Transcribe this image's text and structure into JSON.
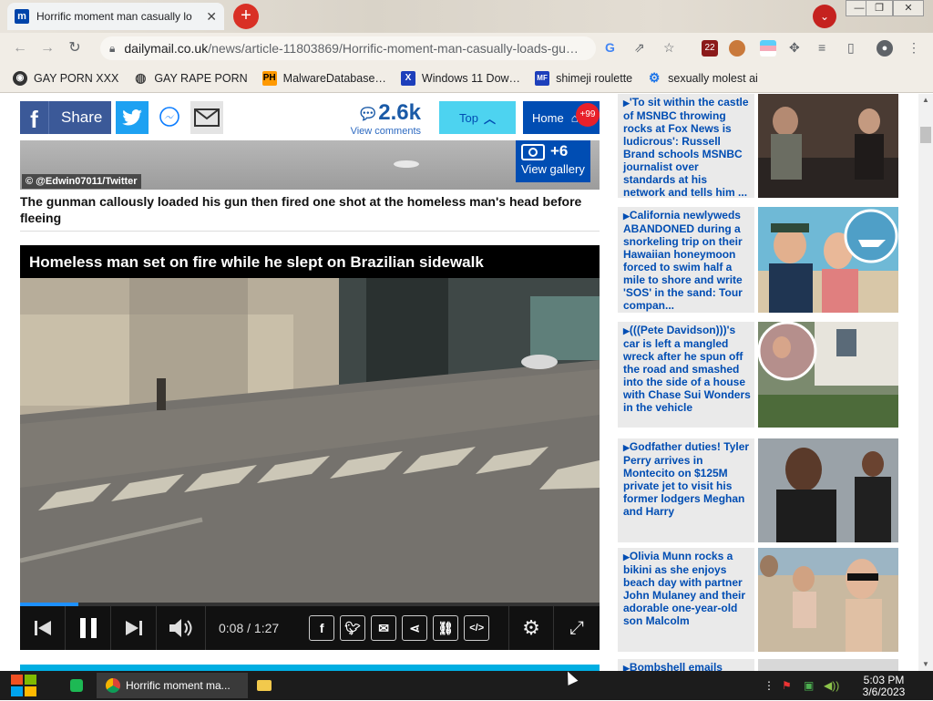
{
  "browser": {
    "tab_title": "Horrific moment man casually lo",
    "tab_favicon": "m",
    "url_host": "dailymail.co.uk",
    "url_path": "/news/article-11803869/Horrific-moment-man-casually-loads-gu…",
    "ext_badge": "22"
  },
  "bookmarks": [
    {
      "label": "GAY PORN XXX",
      "icon": "globe-dark-icon"
    },
    {
      "label": "GAY RAPE PORN",
      "icon": "globe-icon"
    },
    {
      "label": "MalwareDatabase…",
      "icon": "PH"
    },
    {
      "label": "Windows 11 Dow…",
      "icon": "X"
    },
    {
      "label": "shimeji roulette",
      "icon": "MF"
    },
    {
      "label": "sexually molest ai",
      "icon": "puzzle-icon"
    }
  ],
  "sharebar": {
    "share_label": "Share",
    "comments_count": "2.6k",
    "comments_label": "View comments",
    "top_label": "Top",
    "home_label": "Home",
    "home_badge": "+99"
  },
  "photo": {
    "credit": "© @Edwin07011/Twitter",
    "gallery_count": "+6",
    "gallery_label": "View gallery",
    "caption": "The gunman callously loaded his gun then fired one shot at the homeless man's head before fleeing"
  },
  "video": {
    "title": "Homeless man set on fire while he slept on Brazilian sidewalk",
    "time": "0:08 / 1:27",
    "progress": 0.1
  },
  "sidebar": [
    {
      "text": "'To sit within the castle of MSNBC throwing rocks at Fox News is ludicrous': Russell Brand schools MSNBC journalist over standards at his network and tells him ..."
    },
    {
      "text": "California newlyweds ABANDONED during a snorkeling trip on their Hawaiian honeymoon forced to swim half a mile to shore and write 'SOS' in the sand: Tour compan..."
    },
    {
      "text": "(((Pete Davidson)))'s car is left a mangled wreck after he spun off the road and smashed into the side of a house with Chase Sui Wonders in the vehicle"
    },
    {
      "text": "Godfather duties! Tyler Perry arrives in Montecito on $125M private jet to visit his former lodgers Meghan and Harry"
    },
    {
      "text": "Olivia Munn rocks a bikini as she enjoys beach day with partner John Mulaney and their adorable one-year-old son Malcolm"
    },
    {
      "text": "Bombshell emails"
    }
  ],
  "taskbar": {
    "chrome_label": "Horrific moment ma...",
    "clock_time": "5:03 PM",
    "clock_date": "3/6/2023"
  }
}
